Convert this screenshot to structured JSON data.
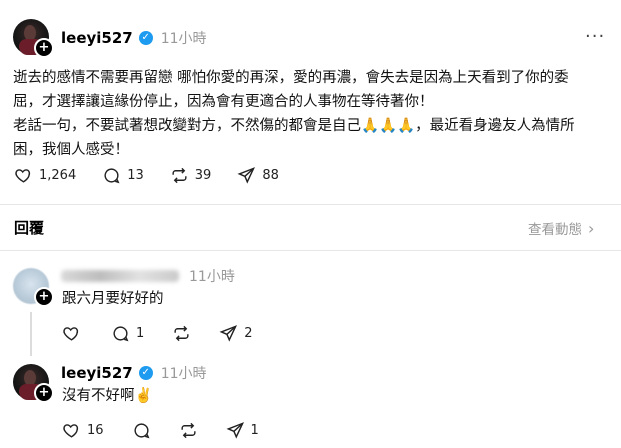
{
  "post": {
    "username": "leeyi527",
    "time": "11小時",
    "more_label": "···",
    "text_line1": "逝去的感情不需要再留戀 哪怕你愛的再深，愛的再濃，會失去是因為上天看到了你的委",
    "text_line2": "屈，才選擇讓這緣份停止，因為會有更適合的人事物在等待著你！",
    "text_line3": "老話一句，不要試著想改變對方，不然傷的都會是自己🙏🙏🙏，最近看身邊友人為情所",
    "text_line4": "困，我個人感受！",
    "likes": "1,264",
    "comments": "13",
    "reposts": "39",
    "shares": "88"
  },
  "replies_bar": {
    "label": "回覆",
    "activity_label": "查看動態"
  },
  "reply1": {
    "time": "11小時",
    "text": "跟六月要好好的",
    "comments": "1",
    "shares": "2"
  },
  "reply2": {
    "username": "leeyi527",
    "time": "11小時",
    "text": "沒有不好啊✌️",
    "likes": "16",
    "shares": "1"
  },
  "colors": {
    "verified": "#1d9bf0",
    "muted": "#999999"
  }
}
